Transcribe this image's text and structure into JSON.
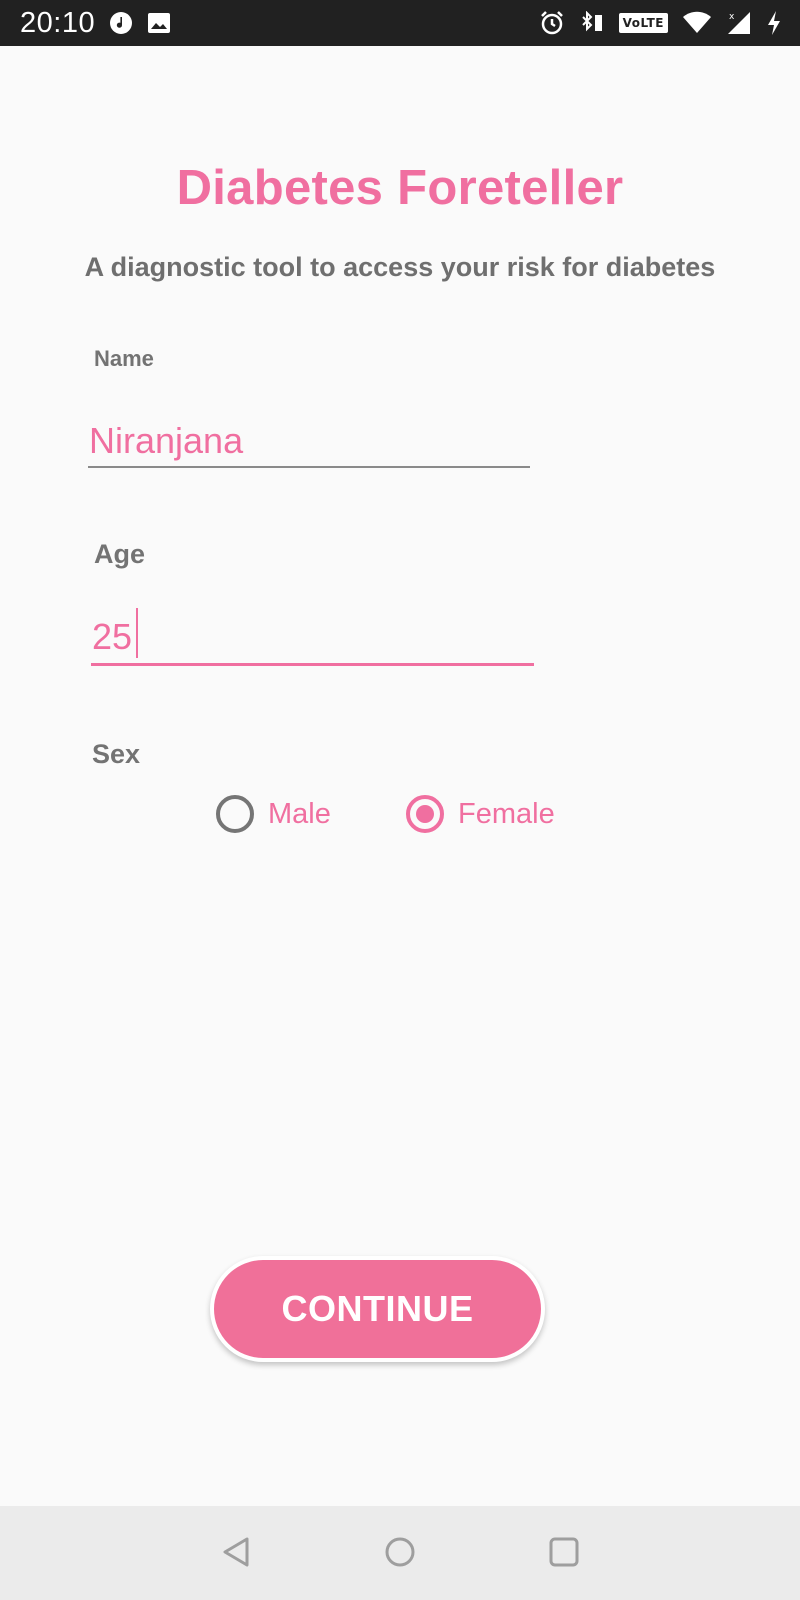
{
  "status_bar": {
    "time": "20:10",
    "network_badge": "VoLTE",
    "icons": [
      "music-icon",
      "image-icon",
      "alarm-icon",
      "bluetooth-vibrate-icon",
      "wifi-icon",
      "cell-signal-icon",
      "charging-icon"
    ]
  },
  "app": {
    "title": "Diabetes Foreteller",
    "subtitle": "A diagnostic tool to access your risk for diabetes"
  },
  "form": {
    "name_label": "Name",
    "name_value": "Niranjana",
    "age_label": "Age",
    "age_value": "25",
    "sex_label": "Sex",
    "sex_options": [
      "Male",
      "Female"
    ],
    "sex_selected": "Female"
  },
  "actions": {
    "continue_label": "CONTINUE"
  },
  "colors": {
    "accent": "#f06fa0",
    "label_gray": "#737373",
    "status_bar": "#212121",
    "nav_bar": "#ebebeb"
  }
}
